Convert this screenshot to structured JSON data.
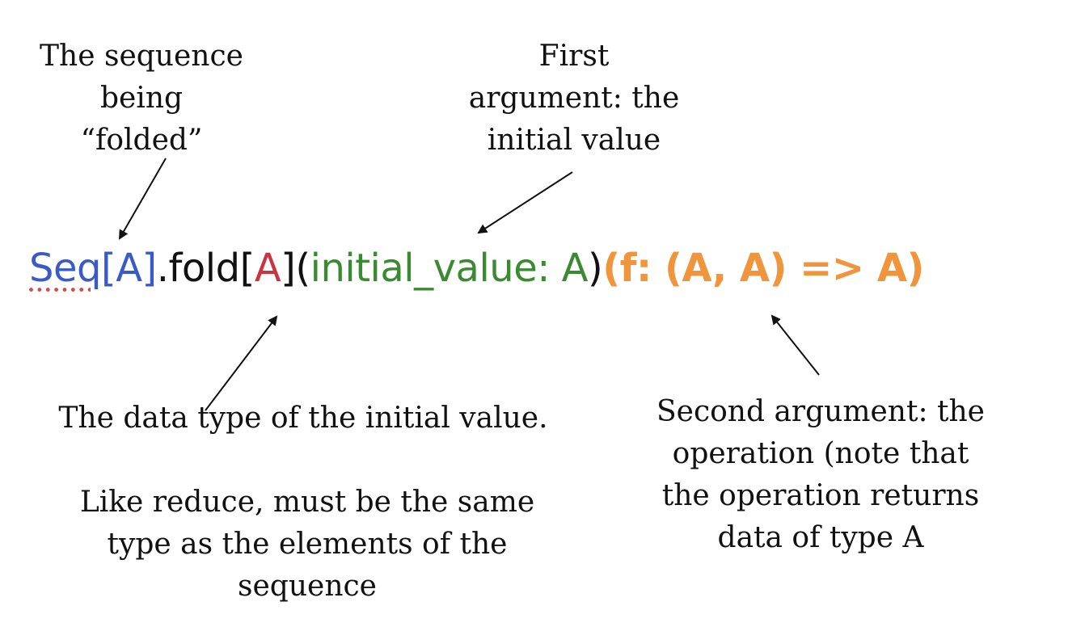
{
  "annotations": {
    "sequence": "The sequence\nbeing\n“folded”",
    "first_argument": "First\nargument: the\ninitial value",
    "data_type": "The data type of the initial value.",
    "like_reduce": "Like reduce, must be the same\ntype as the elements of the\nsequence",
    "second_argument": "Second argument: the\noperation (note that\nthe operation returns\ndata of type A"
  },
  "signature": {
    "seq": "Seq",
    "seq_type": "[A]",
    "fold": ".fold[",
    "type_param": "A",
    "bracket_open_paren": "](",
    "initial_value": "initial_value: A",
    "close_paren": ")",
    "operation": "(f: (A, A) => A)"
  },
  "colors": {
    "seq": "#3a5bc7",
    "type_param": "#cc3340",
    "initial_value": "#3a8a32",
    "operation": "#f0953c",
    "text": "#111111"
  }
}
